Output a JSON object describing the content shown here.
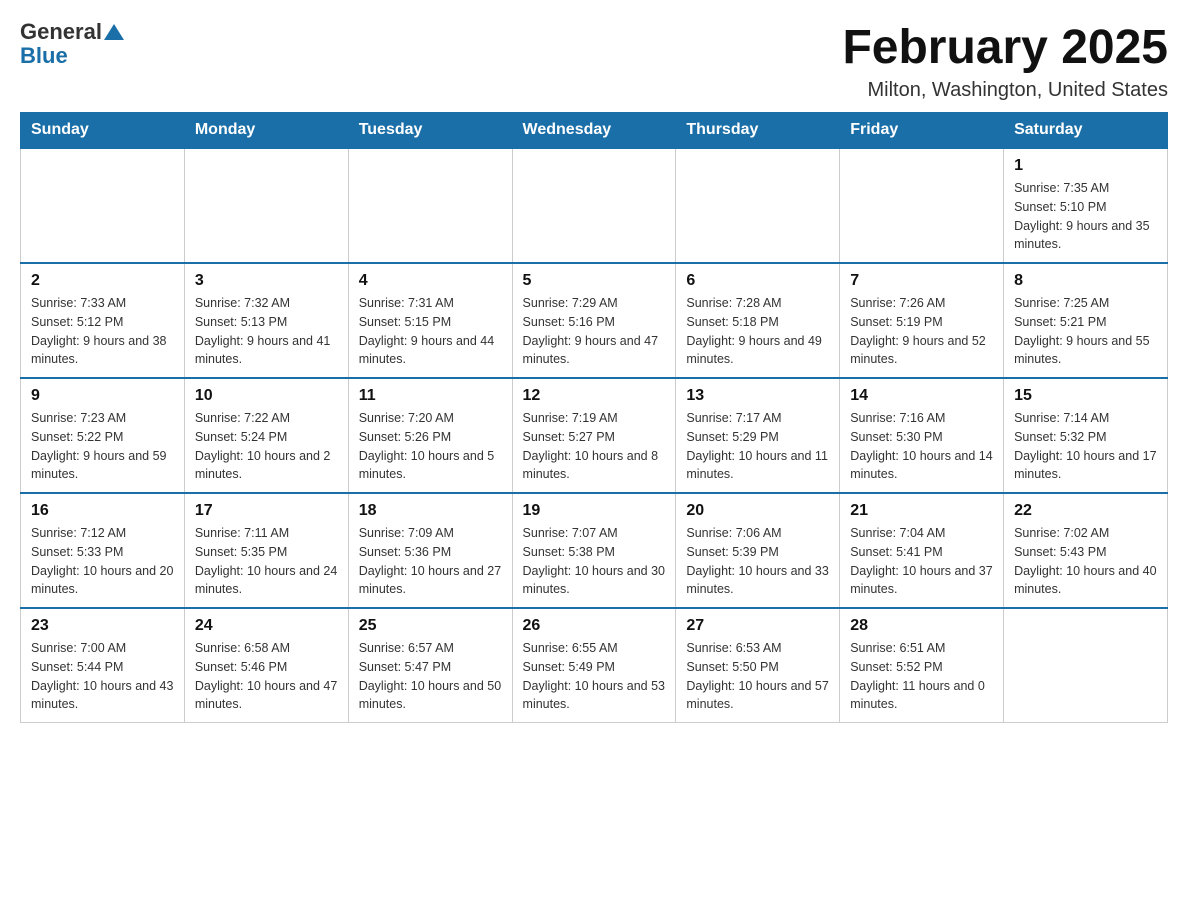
{
  "header": {
    "logo_general": "General",
    "logo_blue": "Blue",
    "title": "February 2025",
    "subtitle": "Milton, Washington, United States"
  },
  "weekdays": [
    "Sunday",
    "Monday",
    "Tuesday",
    "Wednesday",
    "Thursday",
    "Friday",
    "Saturday"
  ],
  "weeks": [
    [
      {
        "day": "",
        "info": ""
      },
      {
        "day": "",
        "info": ""
      },
      {
        "day": "",
        "info": ""
      },
      {
        "day": "",
        "info": ""
      },
      {
        "day": "",
        "info": ""
      },
      {
        "day": "",
        "info": ""
      },
      {
        "day": "1",
        "info": "Sunrise: 7:35 AM\nSunset: 5:10 PM\nDaylight: 9 hours and 35 minutes."
      }
    ],
    [
      {
        "day": "2",
        "info": "Sunrise: 7:33 AM\nSunset: 5:12 PM\nDaylight: 9 hours and 38 minutes."
      },
      {
        "day": "3",
        "info": "Sunrise: 7:32 AM\nSunset: 5:13 PM\nDaylight: 9 hours and 41 minutes."
      },
      {
        "day": "4",
        "info": "Sunrise: 7:31 AM\nSunset: 5:15 PM\nDaylight: 9 hours and 44 minutes."
      },
      {
        "day": "5",
        "info": "Sunrise: 7:29 AM\nSunset: 5:16 PM\nDaylight: 9 hours and 47 minutes."
      },
      {
        "day": "6",
        "info": "Sunrise: 7:28 AM\nSunset: 5:18 PM\nDaylight: 9 hours and 49 minutes."
      },
      {
        "day": "7",
        "info": "Sunrise: 7:26 AM\nSunset: 5:19 PM\nDaylight: 9 hours and 52 minutes."
      },
      {
        "day": "8",
        "info": "Sunrise: 7:25 AM\nSunset: 5:21 PM\nDaylight: 9 hours and 55 minutes."
      }
    ],
    [
      {
        "day": "9",
        "info": "Sunrise: 7:23 AM\nSunset: 5:22 PM\nDaylight: 9 hours and 59 minutes."
      },
      {
        "day": "10",
        "info": "Sunrise: 7:22 AM\nSunset: 5:24 PM\nDaylight: 10 hours and 2 minutes."
      },
      {
        "day": "11",
        "info": "Sunrise: 7:20 AM\nSunset: 5:26 PM\nDaylight: 10 hours and 5 minutes."
      },
      {
        "day": "12",
        "info": "Sunrise: 7:19 AM\nSunset: 5:27 PM\nDaylight: 10 hours and 8 minutes."
      },
      {
        "day": "13",
        "info": "Sunrise: 7:17 AM\nSunset: 5:29 PM\nDaylight: 10 hours and 11 minutes."
      },
      {
        "day": "14",
        "info": "Sunrise: 7:16 AM\nSunset: 5:30 PM\nDaylight: 10 hours and 14 minutes."
      },
      {
        "day": "15",
        "info": "Sunrise: 7:14 AM\nSunset: 5:32 PM\nDaylight: 10 hours and 17 minutes."
      }
    ],
    [
      {
        "day": "16",
        "info": "Sunrise: 7:12 AM\nSunset: 5:33 PM\nDaylight: 10 hours and 20 minutes."
      },
      {
        "day": "17",
        "info": "Sunrise: 7:11 AM\nSunset: 5:35 PM\nDaylight: 10 hours and 24 minutes."
      },
      {
        "day": "18",
        "info": "Sunrise: 7:09 AM\nSunset: 5:36 PM\nDaylight: 10 hours and 27 minutes."
      },
      {
        "day": "19",
        "info": "Sunrise: 7:07 AM\nSunset: 5:38 PM\nDaylight: 10 hours and 30 minutes."
      },
      {
        "day": "20",
        "info": "Sunrise: 7:06 AM\nSunset: 5:39 PM\nDaylight: 10 hours and 33 minutes."
      },
      {
        "day": "21",
        "info": "Sunrise: 7:04 AM\nSunset: 5:41 PM\nDaylight: 10 hours and 37 minutes."
      },
      {
        "day": "22",
        "info": "Sunrise: 7:02 AM\nSunset: 5:43 PM\nDaylight: 10 hours and 40 minutes."
      }
    ],
    [
      {
        "day": "23",
        "info": "Sunrise: 7:00 AM\nSunset: 5:44 PM\nDaylight: 10 hours and 43 minutes."
      },
      {
        "day": "24",
        "info": "Sunrise: 6:58 AM\nSunset: 5:46 PM\nDaylight: 10 hours and 47 minutes."
      },
      {
        "day": "25",
        "info": "Sunrise: 6:57 AM\nSunset: 5:47 PM\nDaylight: 10 hours and 50 minutes."
      },
      {
        "day": "26",
        "info": "Sunrise: 6:55 AM\nSunset: 5:49 PM\nDaylight: 10 hours and 53 minutes."
      },
      {
        "day": "27",
        "info": "Sunrise: 6:53 AM\nSunset: 5:50 PM\nDaylight: 10 hours and 57 minutes."
      },
      {
        "day": "28",
        "info": "Sunrise: 6:51 AM\nSunset: 5:52 PM\nDaylight: 11 hours and 0 minutes."
      },
      {
        "day": "",
        "info": ""
      }
    ]
  ]
}
